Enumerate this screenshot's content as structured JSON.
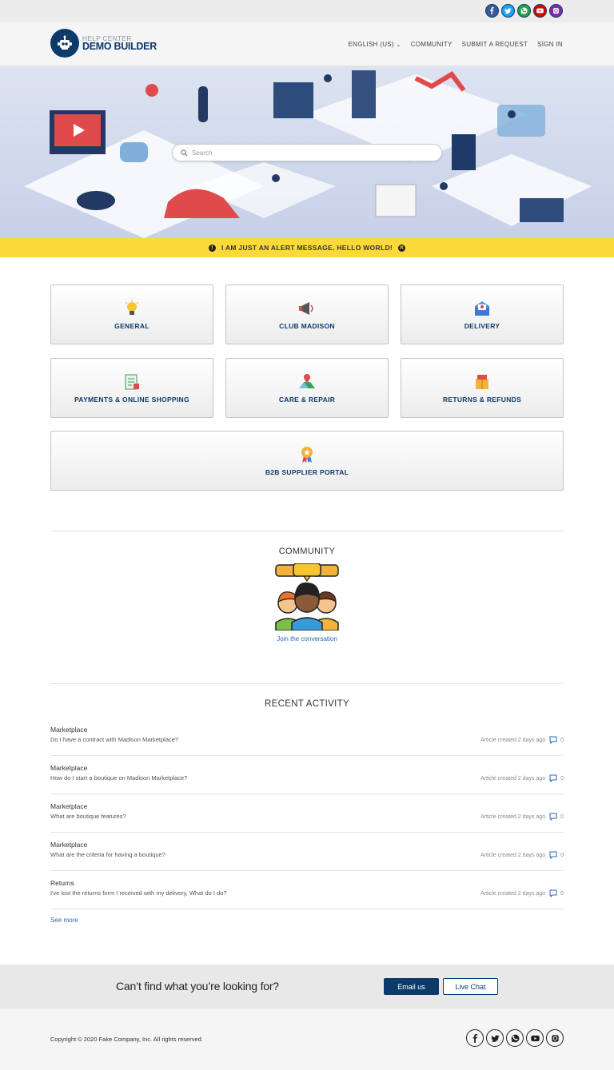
{
  "social": {
    "icons": [
      "facebook-icon",
      "twitter-icon",
      "whatsapp-icon",
      "youtube-icon",
      "instagram-icon"
    ],
    "colors": [
      "#3b5998",
      "#1da1f2",
      "#25a244",
      "#e00000",
      "#7b2fa8"
    ]
  },
  "header": {
    "logo_small": "HELP CENTER",
    "logo_big": "DEMO BUILDER",
    "nav": {
      "language": "ENGLISH (US)",
      "community": "COMMUNITY",
      "submit_request": "SUBMIT A REQUEST",
      "sign_in": "SIGN IN"
    }
  },
  "hero": {
    "search_placeholder": "Search"
  },
  "alert": {
    "message": "I AM JUST AN ALERT MESSAGE. HELLO WORLD!"
  },
  "categories": [
    {
      "label": "GENERAL",
      "icon": "lightbulb-icon"
    },
    {
      "label": "CLUB MADISON",
      "icon": "megaphone-icon"
    },
    {
      "label": "DELIVERY",
      "icon": "mail-icon"
    },
    {
      "label": "PAYMENTS & ONLINE SHOPPING",
      "icon": "checklist-icon"
    },
    {
      "label": "CARE & REPAIR",
      "icon": "map-pin-icon"
    },
    {
      "label": "RETURNS & REFUNDS",
      "icon": "package-icon"
    },
    {
      "label": "B2B SUPPLIER PORTAL",
      "icon": "award-icon"
    }
  ],
  "community": {
    "title": "COMMUNITY",
    "link": "Join the conversation"
  },
  "activity": {
    "title": "RECENT ACTIVITY",
    "items": [
      {
        "section": "Marketplace",
        "title": "Do I have a contract with Madison Marketplace?",
        "meta": "Article created 2 days ago",
        "comments": "0"
      },
      {
        "section": "Marketplace",
        "title": "How do I start a boutique on Madison Marketplace?",
        "meta": "Article created 2 days ago",
        "comments": "0"
      },
      {
        "section": "Marketplace",
        "title": "What are boutique features?",
        "meta": "Article created 2 days ago",
        "comments": "0"
      },
      {
        "section": "Marketplace",
        "title": "What are the criteria for having a boutique?",
        "meta": "Article created 2 days ago",
        "comments": "0"
      },
      {
        "section": "Returns",
        "title": "I've lost the returns form I received with my delivery, What do I do?",
        "meta": "Article created 2 days ago",
        "comments": "0"
      }
    ],
    "see_more": "See more"
  },
  "cta": {
    "question": "Can’t find what you’re looking for?",
    "email": "Email us",
    "chat": "Live Chat"
  },
  "footer": {
    "copyright": "Copyright © 2020 Fake Company, Inc. All rights reserved."
  }
}
